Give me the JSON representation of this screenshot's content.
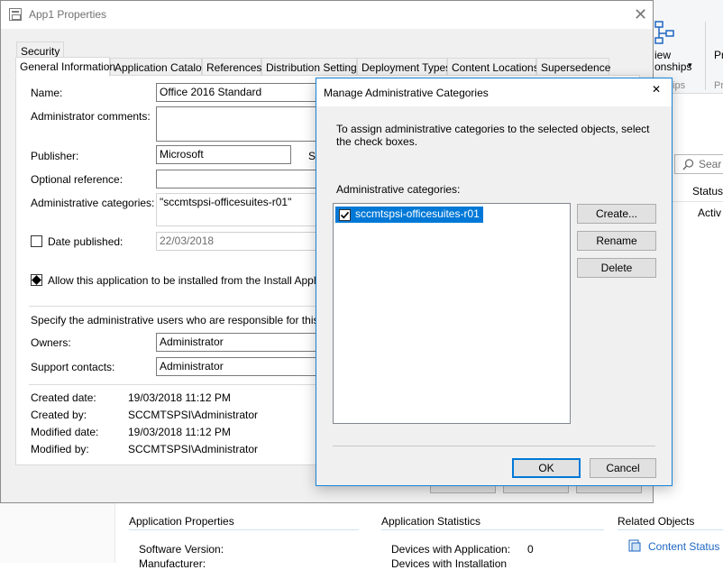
{
  "background": {
    "ribbon": {
      "line1": "iew",
      "line2": "onships",
      "arrow": "▾",
      "group": "hips",
      "right1": "Pr",
      "right2": "Pr"
    },
    "search_placeholder": "Sear",
    "columns": {
      "status_header": "Status",
      "status_value": "Activ"
    },
    "lower": {
      "app_props_heading": "Application Properties",
      "software_version_label": "Software Version:",
      "manufacturer_label": "Manufacturer:",
      "app_stats_heading": "Application Statistics",
      "devices_with_app_label": "Devices with Application:",
      "devices_with_app_value": "0",
      "devices_with_install_label": "Devices with Installation",
      "related_heading": "Related Objects",
      "content_status_link": "Content Status"
    }
  },
  "props_dialog": {
    "title": "App1 Properties",
    "close": "✕",
    "tabs_row1": [
      "Security"
    ],
    "tabs_row2": [
      "General Information",
      "Application Catalog",
      "References",
      "Distribution Settings",
      "Deployment Types",
      "Content Locations",
      "Supersedence"
    ],
    "form": {
      "name_label": "Name:",
      "name_value": "Office 2016 Standard",
      "admin_comments_label": "Administrator comments:",
      "publisher_label": "Publisher:",
      "publisher_value": "Microsoft",
      "software_version_cut": "So",
      "optional_ref_label": "Optional reference:",
      "admin_categories_label": "Administrative categories:",
      "admin_categories_value": "\"sccmtspsi-officesuites-r01\"",
      "date_published_label": "Date published:",
      "date_published_value": "22/03/2018",
      "allow_install_label": "Allow this application to be installed from the Install Application t",
      "specify_admins_label": "Specify the administrative users who are responsible for this applicat",
      "owners_label": "Owners:",
      "owners_value": "Administrator",
      "support_contacts_label": "Support contacts:",
      "support_contacts_value": "Administrator",
      "created_date_label": "Created date:",
      "created_date_value": "19/03/2018 11:12 PM",
      "created_by_label": "Created by:",
      "created_by_value": "SCCMTSPSI\\Administrator",
      "modified_date_label": "Modified date:",
      "modified_date_value": "19/03/2018 11:12 PM",
      "modified_by_label": "Modified by:",
      "modified_by_value": "SCCMTSPSI\\Administrator"
    }
  },
  "modal": {
    "title": "Manage Administrative Categories",
    "close": "✕",
    "description": "To assign administrative categories to the selected objects, select the check boxes.",
    "list_label": "Administrative categories:",
    "items": [
      {
        "label": "sccmtspsi-officesuites-r01",
        "checked": true
      }
    ],
    "create_button": "Create...",
    "rename_button": "Rename",
    "delete_button": "Delete",
    "ok_button": "OK",
    "cancel_button": "Cancel"
  },
  "colors": {
    "accent": "#0078d7",
    "link": "#1e66c2",
    "dialog_bg": "#f0f0f0"
  }
}
